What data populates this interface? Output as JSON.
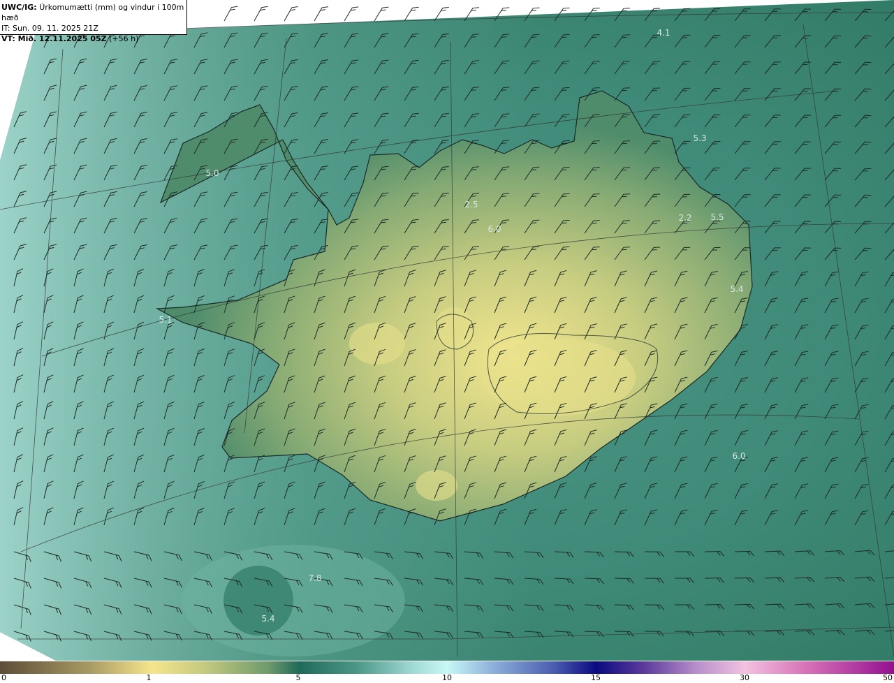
{
  "header": {
    "model": "UWC/IG:",
    "description": "Úrkomumætti (mm) og vindur i 100m hæð",
    "initial_time": "IT: Sun. 09. 11. 2025 21Z",
    "valid_prefix": "VT: Mið. 12.11.2025 05Z",
    "valid_offset": "(+56 h)"
  },
  "map_labels": [
    "4.1",
    "5.3",
    "5.0",
    "2.5",
    "6.0",
    "2.2",
    "5.5",
    "5.4",
    "5.1",
    "6.0",
    "7.8",
    "5.4"
  ],
  "colorbar": {
    "ticks": [
      "0",
      "1",
      "5",
      "10",
      "15",
      "30",
      "50"
    ]
  },
  "colors": {
    "sea": "#5fa898",
    "land_high": "#f0e48c",
    "land_low": "#2e7a66",
    "coast": "#1a2a24"
  }
}
